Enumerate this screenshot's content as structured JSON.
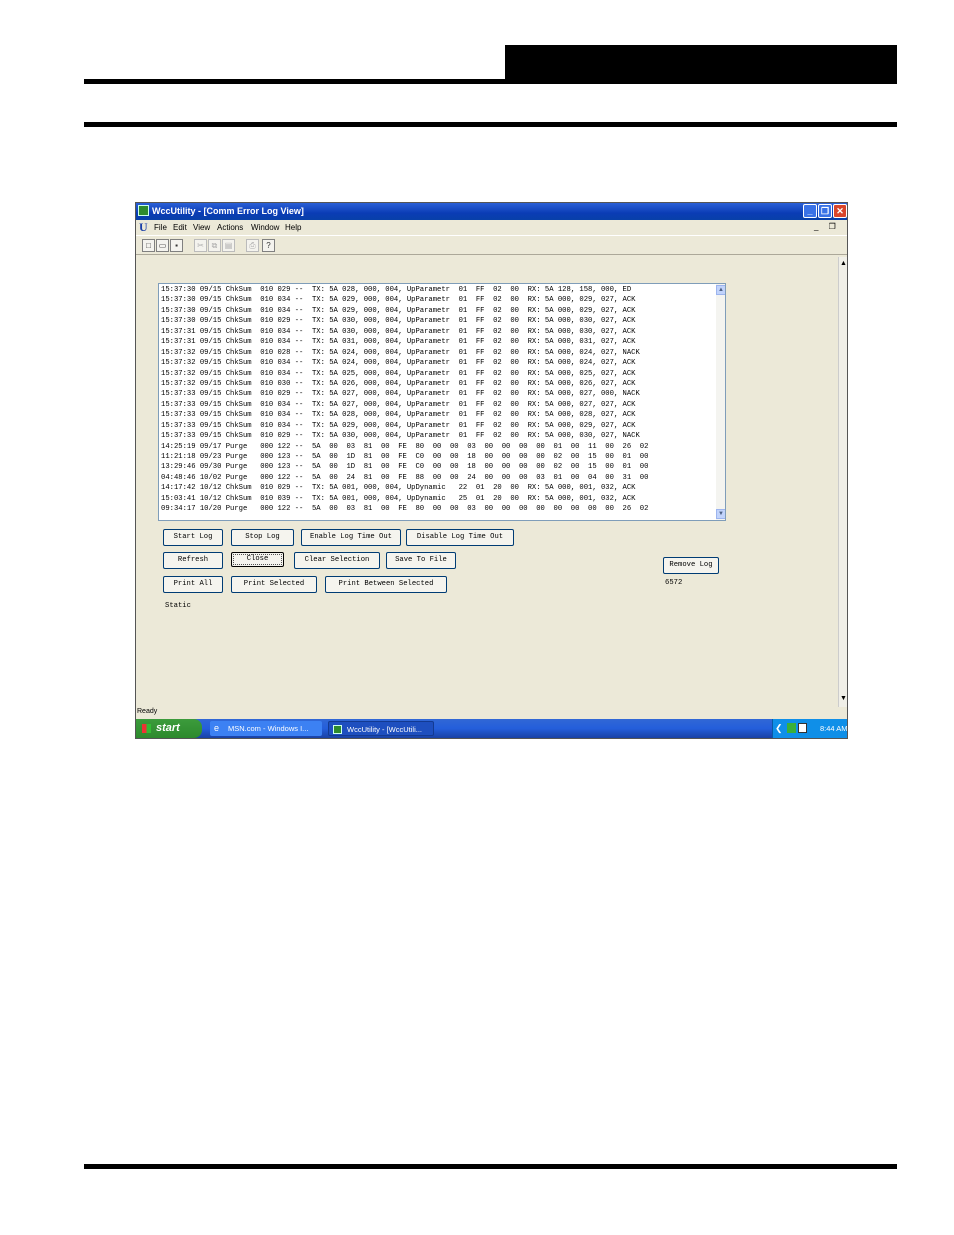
{
  "window": {
    "title": "WccUtility - [Comm Error Log View]",
    "minimize_glyph": "_",
    "maximize_glyph": "❐",
    "close_glyph": "✕",
    "mdi_controls": "_ ❐ ✕"
  },
  "menu": {
    "app_logo": "U",
    "items": [
      "File",
      "Edit",
      "View",
      "Actions",
      "Window",
      "Help"
    ]
  },
  "toolbar": {
    "icons": [
      "new-icon",
      "open-icon",
      "save-icon",
      "cut-icon",
      "copy-icon",
      "paste-icon",
      "print-icon",
      "help-icon"
    ],
    "glyphs": [
      "□",
      "▭",
      "▪",
      "✂",
      "⧉",
      "▤",
      "⎙",
      "?"
    ]
  },
  "log": {
    "lines": [
      "15:37:30 09/15 ChkSum  010 029 --  TX: 5A 028, 000, 004, UpParametr  01  FF  02  00  RX: 5A 128, 158, 000, ED",
      "15:37:30 09/15 ChkSum  010 034 --  TX: 5A 029, 000, 004, UpParametr  01  FF  02  00  RX: 5A 000, 029, 027, ACK",
      "15:37:30 09/15 ChkSum  010 034 --  TX: 5A 029, 000, 004, UpParametr  01  FF  02  00  RX: 5A 000, 029, 027, ACK",
      "15:37:30 09/15 ChkSum  010 029 --  TX: 5A 030, 000, 004, UpParametr  01  FF  02  00  RX: 5A 000, 030, 027, ACK",
      "15:37:31 09/15 ChkSum  010 034 --  TX: 5A 030, 000, 004, UpParametr  01  FF  02  00  RX: 5A 000, 030, 027, ACK",
      "15:37:31 09/15 ChkSum  010 034 --  TX: 5A 031, 000, 004, UpParametr  01  FF  02  00  RX: 5A 000, 031, 027, ACK",
      "15:37:32 09/15 ChkSum  010 028 --  TX: 5A 024, 000, 004, UpParametr  01  FF  02  00  RX: 5A 000, 024, 027, NACK",
      "15:37:32 09/15 ChkSum  010 034 --  TX: 5A 024, 000, 004, UpParametr  01  FF  02  00  RX: 5A 000, 024, 027, ACK",
      "15:37:32 09/15 ChkSum  010 034 --  TX: 5A 025, 000, 004, UpParametr  01  FF  02  00  RX: 5A 000, 025, 027, ACK",
      "15:37:32 09/15 ChkSum  010 030 --  TX: 5A 026, 000, 004, UpParametr  01  FF  02  00  RX: 5A 000, 026, 027, ACK",
      "15:37:33 09/15 ChkSum  010 029 --  TX: 5A 027, 000, 004, UpParametr  01  FF  02  00  RX: 5A 000, 027, 000, NACK",
      "15:37:33 09/15 ChkSum  010 034 --  TX: 5A 027, 000, 004, UpParametr  01  FF  02  00  RX: 5A 000, 027, 027, ACK",
      "15:37:33 09/15 ChkSum  010 034 --  TX: 5A 028, 000, 004, UpParametr  01  FF  02  00  RX: 5A 000, 028, 027, ACK",
      "15:37:33 09/15 ChkSum  010 034 --  TX: 5A 029, 000, 004, UpParametr  01  FF  02  00  RX: 5A 000, 029, 027, ACK",
      "15:37:33 09/15 ChkSum  010 029 --  TX: 5A 030, 000, 004, UpParametr  01  FF  02  00  RX: 5A 000, 030, 027, NACK",
      "14:25:19 09/17 Purge   000 122 --  5A  00  03  81  00  FE  80  00  00  03  00  00  00  00  01  00  11  00  26  02",
      "11:21:18 09/23 Purge   000 123 --  5A  00  1D  81  00  FE  C0  00  00  18  00  00  00  00  02  00  15  00  01  00",
      "13:29:46 09/30 Purge   000 123 --  5A  00  1D  81  00  FE  C0  00  00  18  00  00  00  00  02  00  15  00  01  00",
      "04:48:46 10/02 Purge   000 122 --  5A  00  24  81  00  FE  88  00  00  24  00  00  00  03  01  00  04  00  31  00",
      "14:17:42 10/12 ChkSum  010 029 --  TX: 5A 001, 000, 004, UpDynamic   22  01  20  00  RX: 5A 000, 001, 032, ACK",
      "15:03:41 10/12 ChkSum  010 039 --  TX: 5A 001, 000, 004, UpDynamic   25  01  20  00  RX: 5A 000, 001, 032, ACK",
      "09:34:17 10/20 Purge   000 122 --  5A  00  03  81  00  FE  80  00  00  03  00  00  00  00  00  00  00  00  26  02"
    ]
  },
  "buttons": {
    "start_log": "Start Log",
    "stop_log": "Stop Log",
    "enable_timeout": "Enable Log Time Out",
    "disable_timeout": "Disable Log Time Out",
    "refresh": "Refresh",
    "close": "Close",
    "clear_selection": "Clear Selection",
    "save_to_file": "Save To File",
    "remove_log": "Remove Log",
    "print_all": "Print All",
    "print_selected": "Print Selected",
    "print_between": "Print Between Selected"
  },
  "labels": {
    "static": "Static",
    "count": "6572"
  },
  "status": {
    "text": "Ready"
  },
  "taskbar": {
    "start": "start",
    "tasks": [
      "MSN.com - Windows I...",
      "WccUtility - [WccUtili..."
    ],
    "clock": "8:44 AM"
  },
  "colors": {
    "titlebar": "#0a3cb5",
    "taskbar": "#245edb",
    "start_button": "#2d8a2d",
    "dialog_bg": "#ece9d8"
  }
}
